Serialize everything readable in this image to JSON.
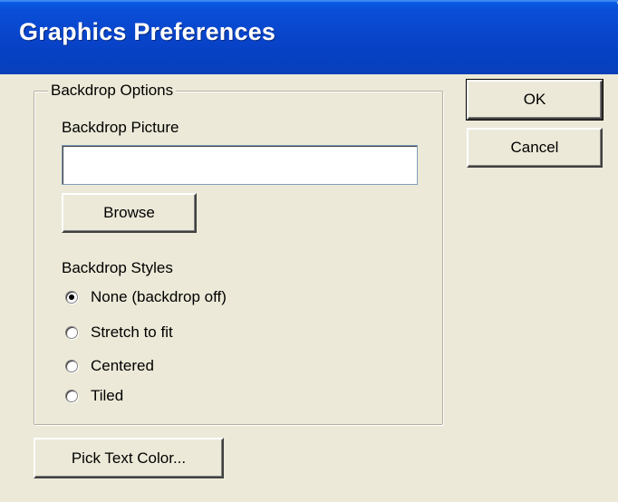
{
  "window": {
    "title": "Graphics Preferences"
  },
  "backdrop_options": {
    "group_label": "Backdrop Options",
    "picture_label": "Backdrop Picture",
    "picture_value": "",
    "browse_label": "Browse",
    "styles_label": "Backdrop Styles",
    "styles": [
      {
        "label": "None (backdrop off)",
        "checked": true
      },
      {
        "label": "Stretch to fit",
        "checked": false
      },
      {
        "label": "Centered",
        "checked": false
      },
      {
        "label": "Tiled",
        "checked": false
      }
    ]
  },
  "buttons": {
    "ok_label": "OK",
    "cancel_label": "Cancel",
    "pick_text_color_label": "Pick Text Color..."
  },
  "colors": {
    "titlebar": "#0843c9",
    "dialog_bg": "#ece9d8"
  }
}
